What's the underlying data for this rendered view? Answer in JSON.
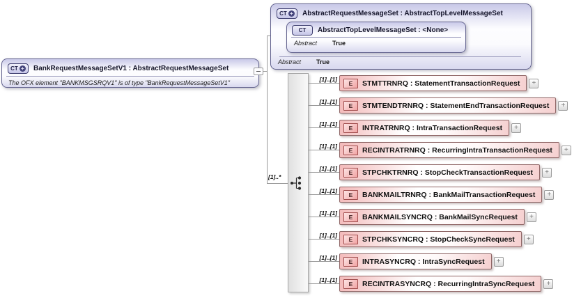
{
  "diagram": {
    "icons": {
      "complex_type": "CT",
      "plus": "+",
      "element": "E",
      "expand": "+"
    },
    "main_type": {
      "title": "BankRequestMessageSetV1 : AbstractRequestMessageSet",
      "annotation": "The OFX element \"BANKMSGSRQV1\" is of type \"BankRequestMessageSetV1\""
    },
    "base_type": {
      "title": "AbstractRequestMessageSet : AbstractTopLevelMessageSet",
      "abstract_label": "Abstract",
      "abstract_value": "True"
    },
    "root_type": {
      "title": "AbstractTopLevelMessageSet : <None>",
      "abstract_label": "Abstract",
      "abstract_value": "True"
    },
    "choice_cardinality": "[1]..*",
    "elements": [
      {
        "cardinality": "[1]..[1]",
        "label": "STMTTRNRQ : StatementTransactionRequest"
      },
      {
        "cardinality": "[1]..[1]",
        "label": "STMTENDTRNRQ : StatementEndTransactionRequest"
      },
      {
        "cardinality": "[1]..[1]",
        "label": "INTRATRNRQ : IntraTransactionRequest"
      },
      {
        "cardinality": "[1]..[1]",
        "label": "RECINTRATRNRQ : RecurringIntraTransactionRequest"
      },
      {
        "cardinality": "[1]..[1]",
        "label": "STPCHKTRNRQ : StopCheckTransactionRequest"
      },
      {
        "cardinality": "[1]..[1]",
        "label": "BANKMAILTRNRQ : BankMailTransactionRequest"
      },
      {
        "cardinality": "[1]..[1]",
        "label": "BANKMAILSYNCRQ : BankMailSyncRequest"
      },
      {
        "cardinality": "[1]..[1]",
        "label": "STPCHKSYNCRQ : StopCheckSyncRequest"
      },
      {
        "cardinality": "[1]..[1]",
        "label": "INTRASYNCRQ : IntraSyncRequest"
      },
      {
        "cardinality": "[1]..[1]",
        "label": "RECINTRASYNCRQ : RecurringIntraSyncRequest"
      }
    ]
  }
}
